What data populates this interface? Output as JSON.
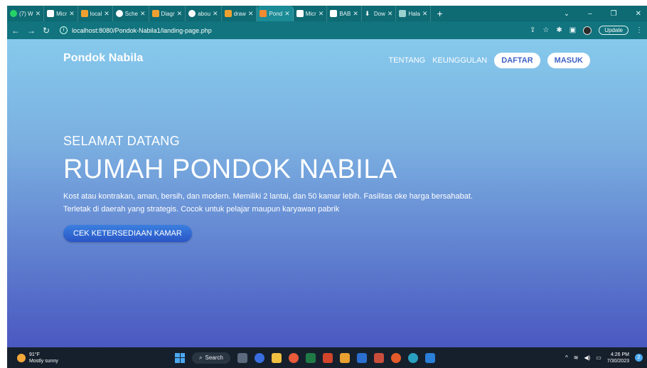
{
  "browser": {
    "tabs": [
      {
        "label": "(7) W",
        "color": "#25d366"
      },
      {
        "label": "Micr",
        "color": "#ffffff"
      },
      {
        "label": "local",
        "color": "#f0a030"
      },
      {
        "label": "Sche",
        "color": "#ffffff"
      },
      {
        "label": "Diagr",
        "color": "#f0a030"
      },
      {
        "label": "abou",
        "color": "#ffffff"
      },
      {
        "label": "draw",
        "color": "#f0a030"
      },
      {
        "label": "Pond",
        "color": "#f08a30",
        "active": true
      },
      {
        "label": "Micr",
        "color": "#ffffff"
      },
      {
        "label": "BAB",
        "color": "#ffffff"
      },
      {
        "label": "Dow",
        "color": "#ffffff"
      },
      {
        "label": "Hala",
        "color": "#9ad0d0"
      }
    ],
    "url": "localhost:8080/Pondok-Nabila1/landing-page.php",
    "update_label": "Update"
  },
  "site": {
    "brand": "Pondok Nabila",
    "nav": {
      "tentang": "TENTANG",
      "keunggulan": "KEUNGGULAN",
      "daftar": "DAFTAR",
      "masuk": "MASUK"
    },
    "hero": {
      "welcome": "SELAMAT DATANG",
      "title": "RUMAH PONDOK NABILA",
      "desc_line1": "Kost atau kontrakan, aman, bersih, dan modern. Memiliki 2 lantai, dan 50 kamar lebih. Fasilitas oke harga bersahabat.",
      "desc_line2": "Terletak di daerah yang strategis. Cocok untuk pelajar maupun karyawan pabrik",
      "cta": "CEK KETERSEDIAAN KAMAR"
    }
  },
  "taskbar": {
    "temp": "91°F",
    "weather": "Mostly sunny",
    "search": "Search",
    "time": "4:26 PM",
    "date": "7/30/2023",
    "notifications": "2",
    "apps": [
      "#5b6b7d",
      "#3a6ee0",
      "#f0c040",
      "#e85a3a",
      "#1f7a45",
      "#d2452c",
      "#e8a030",
      "#2a6fd0",
      "#c84d3a",
      "#e35a2a",
      "#2aa0c0",
      "#2a7fd8"
    ]
  }
}
